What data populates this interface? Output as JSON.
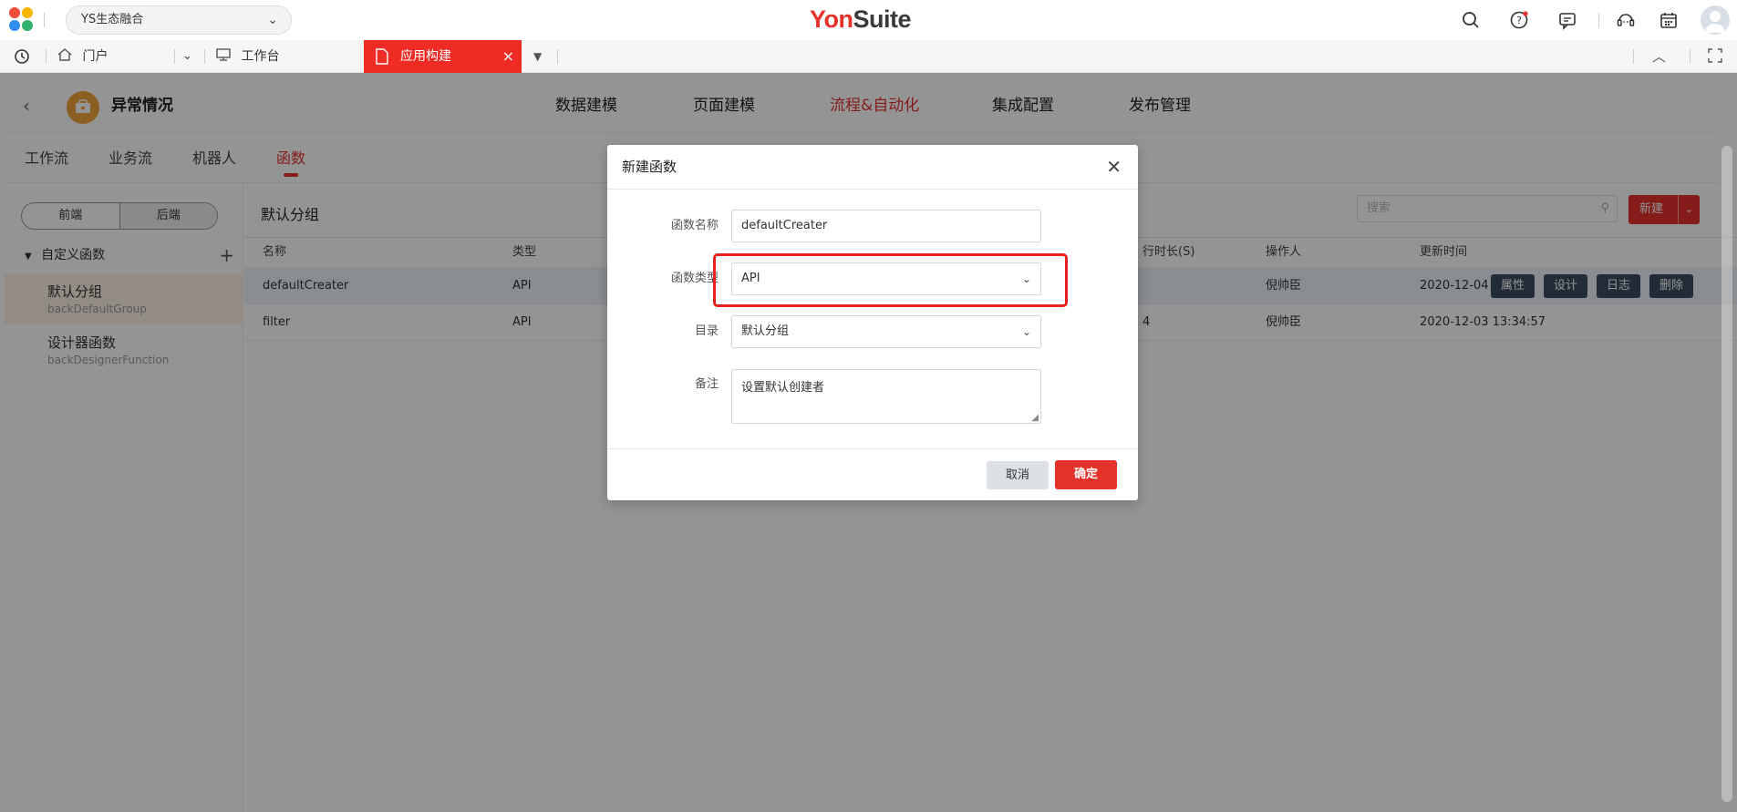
{
  "topbar": {
    "org_select": "YS生态融合",
    "brand_prefix": "Yon",
    "brand_suffix": "Suite",
    "icons": [
      "search-icon",
      "help-icon",
      "message-icon",
      "customer-service-icon",
      "calendar-icon",
      "avatar"
    ]
  },
  "tabbar": {
    "home_label": "门户",
    "workbench_label": "工作台",
    "active_tab_label": "应用构建",
    "active_tab_close": "×"
  },
  "app": {
    "title": "异常情况",
    "modules": [
      "数据建模",
      "页面建模",
      "流程&自动化",
      "集成配置",
      "发布管理"
    ],
    "active_module": "流程&自动化"
  },
  "subtabs": [
    "工作流",
    "业务流",
    "机器人",
    "函数"
  ],
  "sidebar": {
    "segment": [
      "前端",
      "后端"
    ],
    "tree_title": "自定义函数",
    "groups": [
      {
        "name": "默认分组",
        "code": "backDefaultGroup"
      },
      {
        "name": "设计器函数",
        "code": "backDesignerFunction"
      }
    ]
  },
  "main": {
    "title": "默认分组",
    "search_placeholder": "搜索",
    "new_label": "新建",
    "columns": {
      "name": "名称",
      "type": "类型",
      "duration": "行时长(S)",
      "operator": "操作人",
      "updated": "更新时间"
    },
    "rows": [
      {
        "name": "defaultCreater",
        "type": "API",
        "duration": "",
        "operator": "倪帅臣",
        "updated": "2020-12-04"
      },
      {
        "name": "filter",
        "type": "API",
        "duration": "4",
        "operator": "倪帅臣",
        "updated": "2020-12-03 13:34:57"
      }
    ],
    "row_actions": [
      "属性",
      "设计",
      "日志",
      "删除"
    ]
  },
  "modal": {
    "title": "新建函数",
    "fields": {
      "name_label": "函数名称",
      "name_value": "defaultCreater",
      "type_label": "函数类型",
      "type_value": "API",
      "dir_label": "目录",
      "dir_value": "默认分组",
      "note_label": "备注",
      "note_value": "设置默认创建者"
    },
    "cancel_label": "取消",
    "ok_label": "确定"
  },
  "colors": {
    "accent": "#e4322b",
    "dark_button": "#3c4d62"
  }
}
